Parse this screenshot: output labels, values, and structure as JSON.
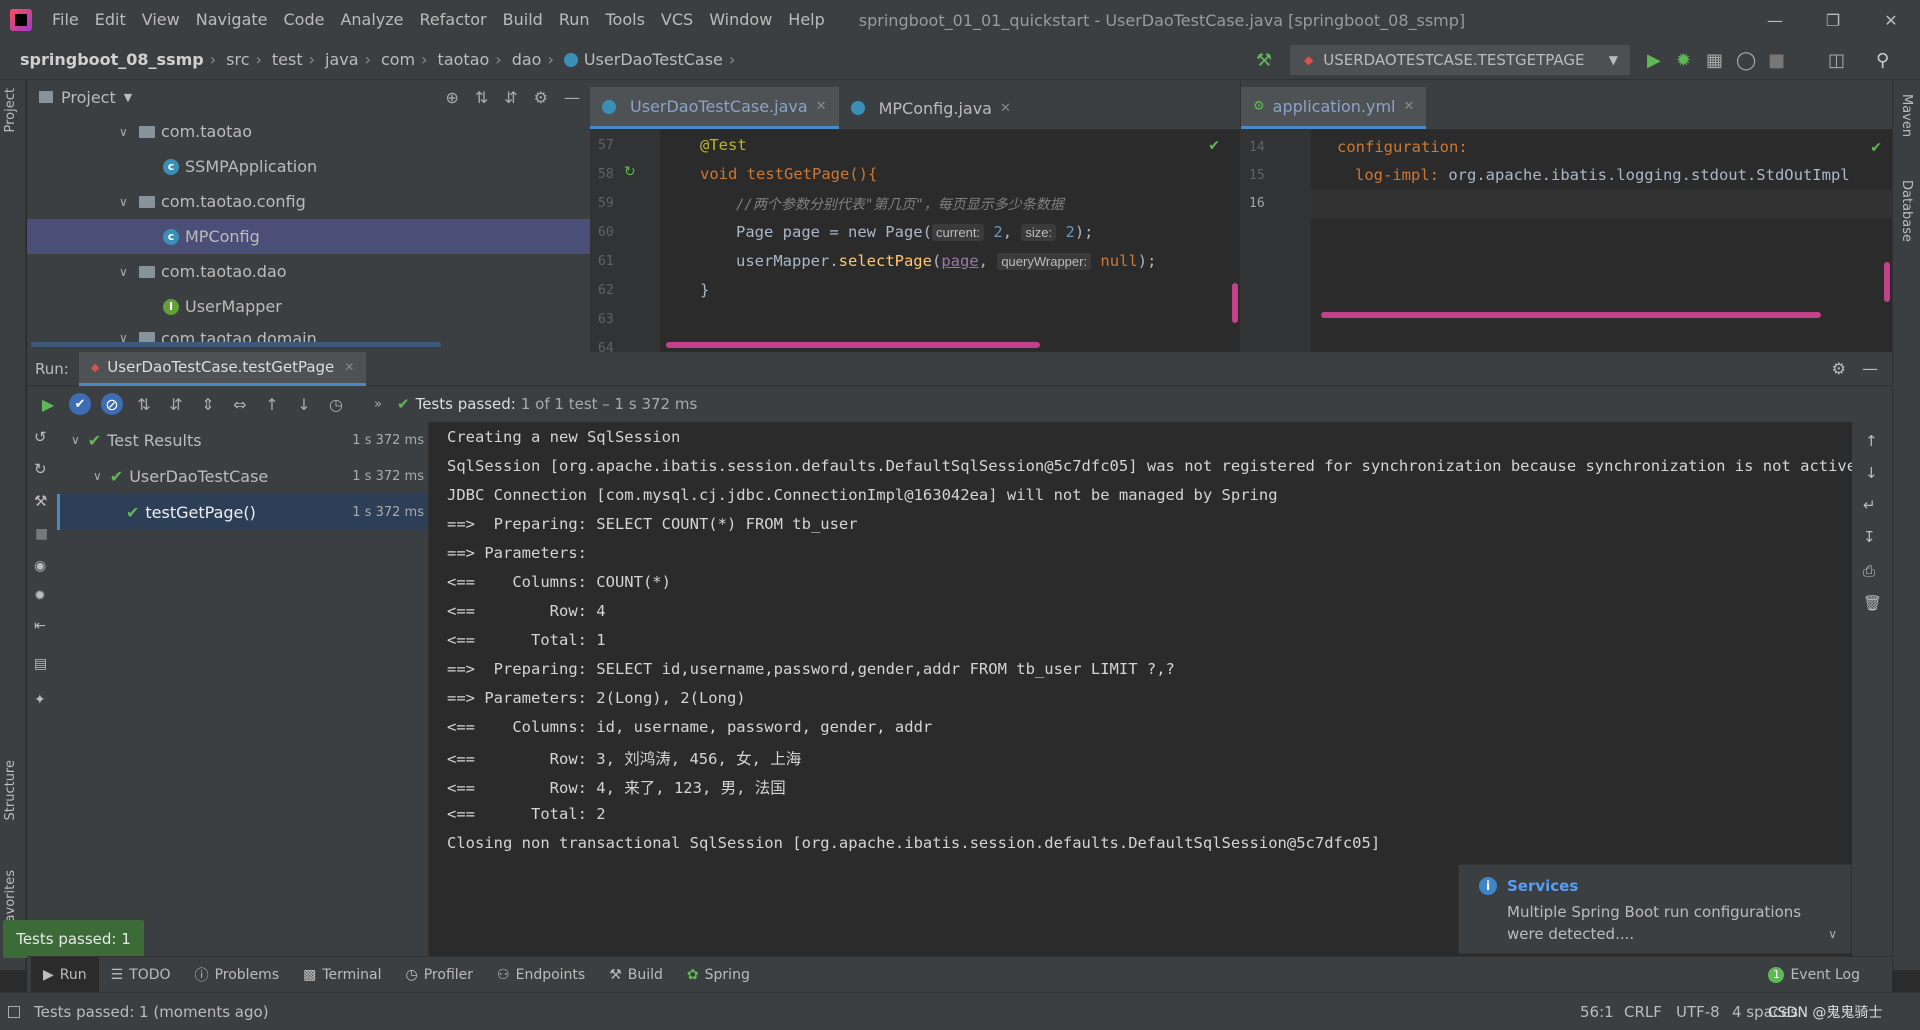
{
  "window": {
    "title": "springboot_01_01_quickstart - UserDaoTestCase.java [springboot_08_ssmp]",
    "menu": [
      "File",
      "Edit",
      "View",
      "Navigate",
      "Code",
      "Analyze",
      "Refactor",
      "Build",
      "Run",
      "Tools",
      "VCS",
      "Window",
      "Help"
    ]
  },
  "breadcrumb": [
    "springboot_08_ssmp",
    "src",
    "test",
    "java",
    "com",
    "taotao",
    "dao",
    "UserDaoTestCase"
  ],
  "run_config": "USERDAOTESTCASE.TESTGETPAGE",
  "project": {
    "title": "Project",
    "tree": [
      {
        "label": "com.taotao",
        "type": "folder",
        "indent": 1
      },
      {
        "label": "SSMPApplication",
        "type": "class-run",
        "indent": 2
      },
      {
        "label": "com.taotao.config",
        "type": "folder",
        "indent": 1
      },
      {
        "label": "MPConfig",
        "type": "class",
        "indent": 2,
        "selected": true
      },
      {
        "label": "com.taotao.dao",
        "type": "folder",
        "indent": 1
      },
      {
        "label": "UserMapper",
        "type": "interface",
        "indent": 2
      },
      {
        "label": "com.taotao.domain",
        "type": "folder",
        "indent": 1
      }
    ]
  },
  "editor_left": {
    "tabs": [
      {
        "label": "UserDaoTestCase.java",
        "active": true
      },
      {
        "label": "MPConfig.java",
        "active": false
      }
    ],
    "line_numbers": [
      "57",
      "58",
      "59",
      "60",
      "61",
      "62",
      "63",
      "64"
    ],
    "lines": {
      "l57": "@Test",
      "l58": "void testGetPage(){",
      "l59": "//两个参数分别代表\"第几页\"，每页显示多少条数据",
      "l60a": "Page page = new Page(",
      "l60_hint1": "current:",
      "l60_v1": "2",
      "l60_hint2": "size:",
      "l60_v2": "2",
      "l60b": ");",
      "l61a": "userMapper.",
      "l61_fn": "selectPage",
      "l61_arg": "page",
      "l61_hint": "queryWrapper:",
      "l61_null": "null",
      "l61b": ");",
      "l62": "}"
    }
  },
  "editor_right": {
    "tabs": [
      {
        "label": "application.yml",
        "active": true
      }
    ],
    "line_numbers": [
      "14",
      "15",
      "16"
    ],
    "l14": "configuration:",
    "l15_key": "log-impl:",
    "l15_val": "org.apache.ibatis.logging.stdout.StdOutImpl"
  },
  "run": {
    "label": "Run:",
    "tab": "UserDaoTestCase.testGetPage",
    "status_prefix": "Tests passed:",
    "status_rest": "1 of 1 test – 1 s 372 ms",
    "tree": [
      {
        "label": "Test Results",
        "dur": "1 s 372 ms",
        "indent": 0
      },
      {
        "label": "UserDaoTestCase",
        "dur": "1 s 372 ms",
        "indent": 1
      },
      {
        "label": "testGetPage()",
        "dur": "1 s 372 ms",
        "indent": 2,
        "selected": true
      }
    ],
    "console": [
      "Creating a new SqlSession",
      "SqlSession [org.apache.ibatis.session.defaults.DefaultSqlSession@5c7dfc05] was not registered for synchronization because synchronization is not active",
      "JDBC Connection [com.mysql.cj.jdbc.ConnectionImpl@163042ea] will not be managed by Spring",
      "==>  Preparing: SELECT COUNT(*) FROM tb_user",
      "==> Parameters: ",
      "<==    Columns: COUNT(*)",
      "<==        Row: 4",
      "<==      Total: 1",
      "==>  Preparing: SELECT id,username,password,gender,addr FROM tb_user LIMIT ?,?",
      "==> Parameters: 2(Long), 2(Long)",
      "<==    Columns: id, username, password, gender, addr",
      "<==        Row: 3, 刘鸿涛, 456, 女, 上海",
      "<==        Row: 4, 来了, 123, 男, 法国",
      "<==      Total: 2",
      "Closing non transactional SqlSession [org.apache.ibatis.session.defaults.DefaultSqlSession@5c7dfc05]"
    ]
  },
  "notification": {
    "title": "Services",
    "body": "Multiple Spring Boot run configurations were detected...."
  },
  "toast": "Tests passed: 1",
  "bottom_tabs": [
    "Run",
    "TODO",
    "Problems",
    "Terminal",
    "Profiler",
    "Endpoints",
    "Build",
    "Spring"
  ],
  "event_log": "Event Log",
  "left_vtabs": [
    "Project",
    "Structure",
    "Favorites"
  ],
  "right_vtabs": [
    "Maven",
    "Database"
  ],
  "status": {
    "message": "Tests passed: 1 (moments ago)",
    "position": "56:1",
    "line_sep": "CRLF",
    "encoding": "UTF-8",
    "indent": "4 spaces",
    "watermark": "CSDN @鬼鬼骑士"
  }
}
